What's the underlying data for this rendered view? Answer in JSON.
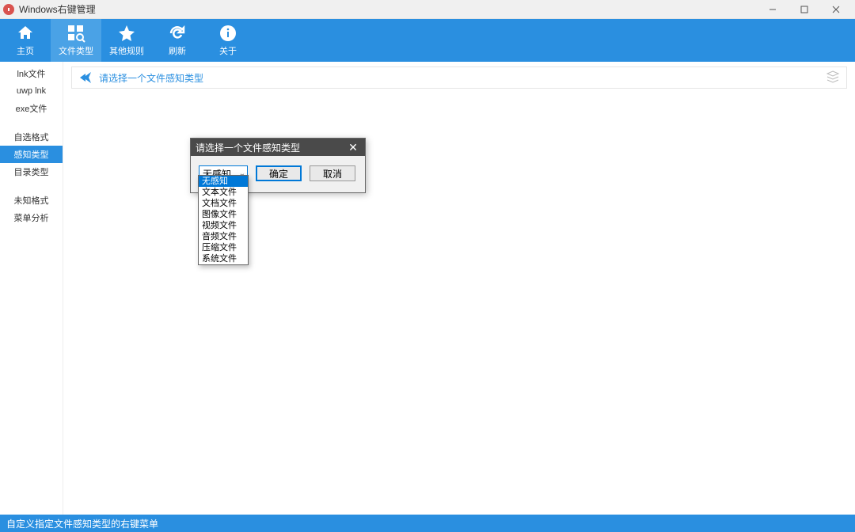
{
  "window": {
    "title": "Windows右键管理"
  },
  "toolbar": {
    "home": "主页",
    "file_type": "文件类型",
    "other_rules": "其他规则",
    "refresh": "刷新",
    "about": "关于"
  },
  "sidebar": {
    "items": [
      "lnk文件",
      "uwp lnk",
      "exe文件"
    ],
    "group2": [
      "自选格式",
      "感知类型",
      "目录类型"
    ],
    "group3": [
      "未知格式",
      "菜单分析"
    ],
    "active": "感知类型"
  },
  "info": {
    "text": "请选择一个文件感知类型"
  },
  "dialog": {
    "title": "请选择一个文件感知类型",
    "combo_value": "无感知",
    "ok": "确定",
    "cancel": "取消",
    "options": [
      "无感知",
      "文本文件",
      "文档文件",
      "图像文件",
      "视频文件",
      "音频文件",
      "压缩文件",
      "系统文件"
    ],
    "selected_index": 0
  },
  "status": {
    "text": "自定义指定文件感知类型的右键菜单"
  }
}
